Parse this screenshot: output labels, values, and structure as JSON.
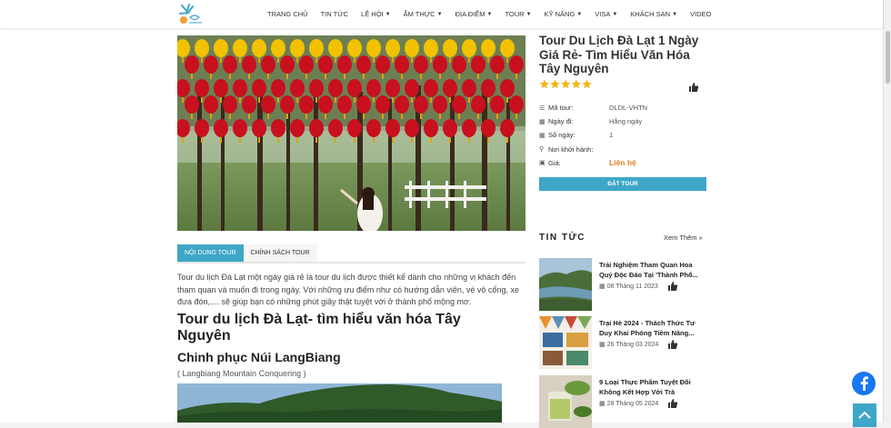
{
  "nav": {
    "items": [
      {
        "label": "TRANG CHỦ",
        "caret": false
      },
      {
        "label": "TIN TỨC",
        "caret": false
      },
      {
        "label": "LỄ HỘI",
        "caret": true
      },
      {
        "label": "ẨM THỰC",
        "caret": true
      },
      {
        "label": "ĐỊA ĐIỂM",
        "caret": true
      },
      {
        "label": "TOUR",
        "caret": true
      },
      {
        "label": "KỸ NĂNG",
        "caret": true
      },
      {
        "label": "VISA",
        "caret": true
      },
      {
        "label": "KHÁCH SẠN",
        "caret": true
      },
      {
        "label": "VIDEO",
        "caret": false
      }
    ]
  },
  "tour": {
    "title": "Tour Du Lịch Đà Lạt 1 Ngày Giá Rẻ- Tìm Hiểu Văn Hóa Tây Nguyên",
    "rating": 5,
    "fields": [
      {
        "icon": "list-icon",
        "label": "Mã tour:",
        "value": "DLDL-VHTN",
        "price": false
      },
      {
        "icon": "calendar-icon",
        "label": "Ngày đi:",
        "value": "Hằng ngày",
        "price": false
      },
      {
        "icon": "calendar-icon",
        "label": "Số ngày:",
        "value": "1",
        "price": false
      },
      {
        "icon": "location-icon",
        "label": "Nơi khởi hành:",
        "value": "",
        "price": false
      },
      {
        "icon": "money-icon",
        "label": "Giá:",
        "value": "Liên hệ",
        "price": true
      }
    ],
    "book_label": "ĐẶT TOUR"
  },
  "content": {
    "tabs": [
      {
        "label": "NỘI DUNG TOUR",
        "active": true
      },
      {
        "label": "CHÍNH SÁCH TOUR",
        "active": false
      }
    ],
    "intro": "Tour du lịch Đà Lạt một ngày giá rẻ là tour du lịch được thiết kế dành cho những vị khách đến tham quan và muốn đi trong ngày. Với những ưu điểm như có hướng dẫn viên, vé vô cổng, xe đưa đón,.... sẽ giúp bạn có những phút giây thật tuyệt vời ở thành phố mộng mơ.",
    "heading": "Tour du lịch Đà Lạt- tìm hiểu văn hóa Tây Nguyên",
    "subheading": "Chinh phục Núi LangBiang",
    "caption": "( Langbiang Mountain Conquering )"
  },
  "news": {
    "heading": "TIN TỨC",
    "more": "Xem Thêm »",
    "items": [
      {
        "title": "Trải Nghiệm Tham Quan Hoa Quý Độc Đáo Tại 'Thành Phố...",
        "date": "08 Tháng 11 2023"
      },
      {
        "title": "Trại Hè 2024 - Thách Thức Tư Duy Khai Phóng Tiềm Năng...",
        "date": "26 Tháng 03 2024"
      },
      {
        "title": "9 Loại Thực Phẩm Tuyệt Đối Không Kết Hợp Với Trà",
        "date": "28 Tháng 05 2024"
      }
    ]
  },
  "colors": {
    "accent": "#3ea7c7",
    "price": "#e67e22",
    "star": "#f5b301",
    "facebook": "#1877f2"
  }
}
